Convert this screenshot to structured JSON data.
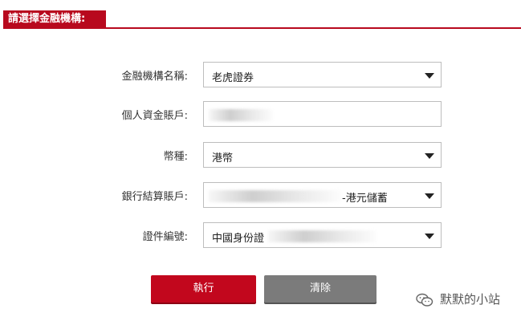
{
  "header": {
    "title": "請選擇金融機構:"
  },
  "form": {
    "institution": {
      "label": "金融機構名稱:",
      "value": "老虎證券"
    },
    "personal_account": {
      "label": "個人資金賬戶:",
      "value": ""
    },
    "currency": {
      "label": "幣種:",
      "value": "港幣"
    },
    "bank_account": {
      "label": "銀行結算賬戶:",
      "value_suffix": "-港元儲蓄"
    },
    "id_document": {
      "label": "證件編號:",
      "value": "中國身份證"
    }
  },
  "buttons": {
    "execute": "執行",
    "clear": "清除"
  },
  "watermark": {
    "text": "默默的小站"
  },
  "colors": {
    "brand_red": "#b8091e",
    "clear_gray": "#7b7b7b"
  }
}
